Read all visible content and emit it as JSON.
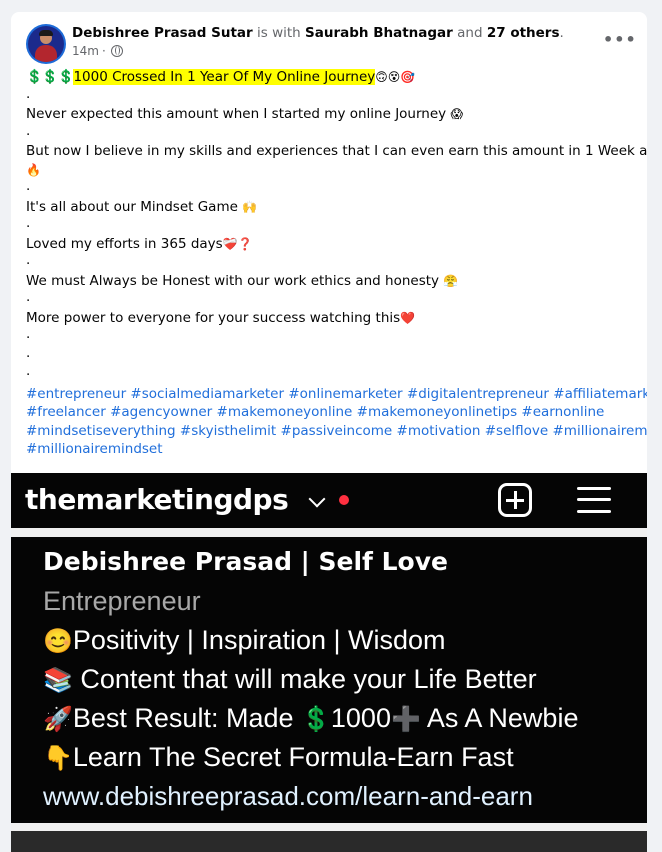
{
  "post": {
    "author": "Debishree Prasad Sutar",
    "with_text": "is with",
    "tagged": "Saurabh Bhatnagar",
    "and_text": "and",
    "others": "27 others",
    "period": ".",
    "time": "14m",
    "separator": "·",
    "more": "•••",
    "headline_prefix": "💲💲💲",
    "headline": "1000 Crossed In 1 Year Of My Online Journey",
    "headline_emojis": "🙃😵🎯",
    "dot": ".",
    "l1": "Never expected this amount when I started my online Journey",
    "l1_emoji": "😱",
    "l2": "But now I believe in my skills and experiences that I can even earn this amount in 1 Week also",
    "l2_emoji": "💰",
    "l2b": "🔥",
    "l3": "It's all about our Mindset Game",
    "l3_emoji": "🙌",
    "l4": "Loved my efforts in 365 days",
    "l4_emoji": "❤️‍🩹❓",
    "l5": "We must Always be Honest with our work ethics and honesty",
    "l5_emoji": "😤",
    "l6": "More power to everyone for your success watching this",
    "l6_emoji": "❤️",
    "hashtags": [
      [
        "#entrepreneur",
        "#socialmediamarketer",
        "#onlinemarketer",
        "#digitalentrepreneur",
        "#affiliatemarketer"
      ],
      [
        "#freelancer",
        "#agencyowner",
        "#makemoneyonline",
        "#makemoneyonlinetips",
        "#earnonline"
      ],
      [
        "#mindsetiseverything",
        "#skyisthelimit",
        "#passiveincome",
        "#motivation",
        "#selflove",
        "#millionairemotivation"
      ],
      [
        "#millionairemindset"
      ]
    ]
  },
  "image": {
    "username": "themarketingdps",
    "bio_name": "Debishree Prasad | Self Love",
    "category": "Entrepreneur",
    "b1_emoji": "😊",
    "b1": "Positivity | Inspiration | Wisdom",
    "b2_emoji": "📚",
    "b2": " Content that will make your Life Better",
    "b3_emoji": "🚀",
    "b3a": "Best Result: Made ",
    "b3_dollar": "💲",
    "b3b": "1000",
    "b3_plus": "➕",
    "b3c": " As A Newbie",
    "b4_emoji": "👇",
    "b4": "Learn The Secret Formula-Earn Fast",
    "link": "www.debishreeprasad.com/learn-and-earn"
  },
  "colors": {
    "highlight": "#ffff00",
    "hashtag": "#216fdb",
    "ig_background": "#050505"
  }
}
